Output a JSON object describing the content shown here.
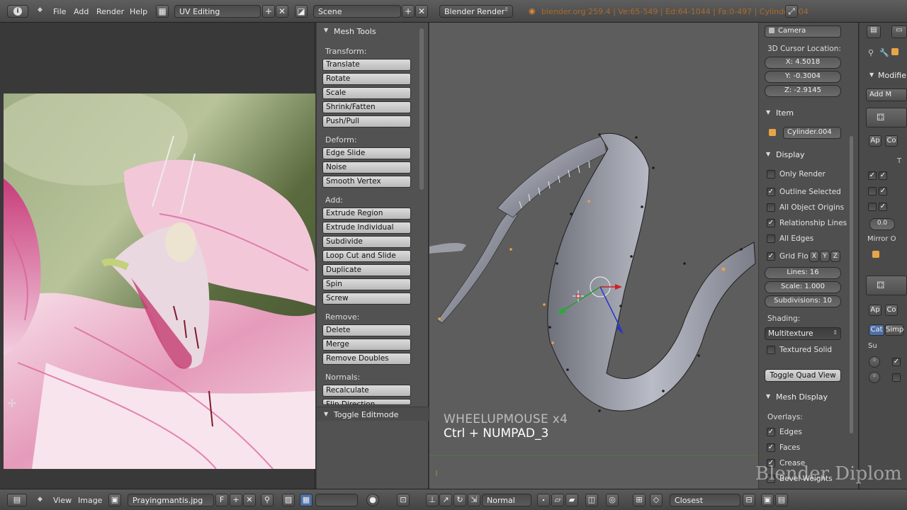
{
  "header": {
    "menus": [
      "File",
      "Add",
      "Render",
      "Help"
    ],
    "screen_layout": "UV Editing",
    "scene": "Scene",
    "render_engine": "Blender Render",
    "info": "blender.org 259.4 | Ve:65-549 | Ed:64-1044 | Fa:0-497 | Cylinder.004"
  },
  "tool_panel": {
    "title": "Mesh Tools",
    "sections": [
      {
        "label": "Transform:",
        "buttons": [
          "Translate",
          "Rotate",
          "Scale",
          "Shrink/Fatten",
          "Push/Pull"
        ]
      },
      {
        "label": "Deform:",
        "buttons": [
          "Edge Slide",
          "Noise",
          "Smooth Vertex"
        ]
      },
      {
        "label": "Add:",
        "buttons": [
          "Extrude Region",
          "Extrude Individual",
          "Subdivide",
          "Loop Cut and Slide",
          "Duplicate",
          "Spin",
          "Screw"
        ]
      },
      {
        "label": "Remove:",
        "buttons": [
          "Delete",
          "Merge",
          "Remove Doubles"
        ]
      },
      {
        "label": "Normals:",
        "buttons": [
          "Recalculate",
          "Flip Direction"
        ]
      }
    ],
    "toggle_editmode": "Toggle Editmode"
  },
  "viewport": {
    "overlay_line1": "WHEELUPMOUSE x4",
    "overlay_line2": "Ctrl + NUMPAD_3"
  },
  "properties_panel": {
    "camera": "Camera",
    "cursor_label": "3D Cursor Location:",
    "cursor_x": "X: 4.5018",
    "cursor_y": "Y: -0.3004",
    "cursor_z": "Z: -2.9145",
    "item_title": "Item",
    "item_name": "Cylinder.004",
    "display_title": "Display",
    "checks": [
      {
        "label": "Only Render",
        "checked": false
      },
      {
        "label": "Outline Selected",
        "checked": true
      },
      {
        "label": "All Object Origins",
        "checked": false
      },
      {
        "label": "Relationship Lines",
        "checked": true
      },
      {
        "label": "All Edges",
        "checked": false
      }
    ],
    "grid_floor": "Grid Flo",
    "axes": [
      "X",
      "Y",
      "Z"
    ],
    "lines": "Lines: 16",
    "scale": "Scale: 1.000",
    "subdivisions": "Subdivisions: 10",
    "shading_label": "Shading:",
    "shading_value": "Multitexture",
    "textured_solid": "Textured Solid",
    "toggle_quad_view": "Toggle Quad View",
    "mesh_display_title": "Mesh Display",
    "overlays_label": "Overlays:",
    "overlay_checks": [
      {
        "label": "Edges",
        "checked": true
      },
      {
        "label": "Faces",
        "checked": true
      },
      {
        "label": "Crease",
        "checked": true
      },
      {
        "label": "Bevel Weights",
        "checked": false
      }
    ]
  },
  "properties_editor": {
    "modifiers_title": "Modifier",
    "add_modifier": "Add M",
    "apply": "Ap",
    "copy": "Co",
    "value": "0.0",
    "mirror": "Mirror O",
    "catmull": "Cat",
    "simple": "Simp",
    "subdiv": "Su",
    "t_label": "T"
  },
  "bottom_bar": {
    "menus": [
      "View",
      "Image"
    ],
    "image_name": "Prayingmantis.jpg",
    "fake_user": "F",
    "shading_mode": "Normal",
    "snap_element": "Closest"
  },
  "watermark": "Blender Diplom",
  "colors": {
    "accent_orange": "#f0a040",
    "selected_checkbox": "#ffffff",
    "button_light": "#c8c8c8"
  }
}
